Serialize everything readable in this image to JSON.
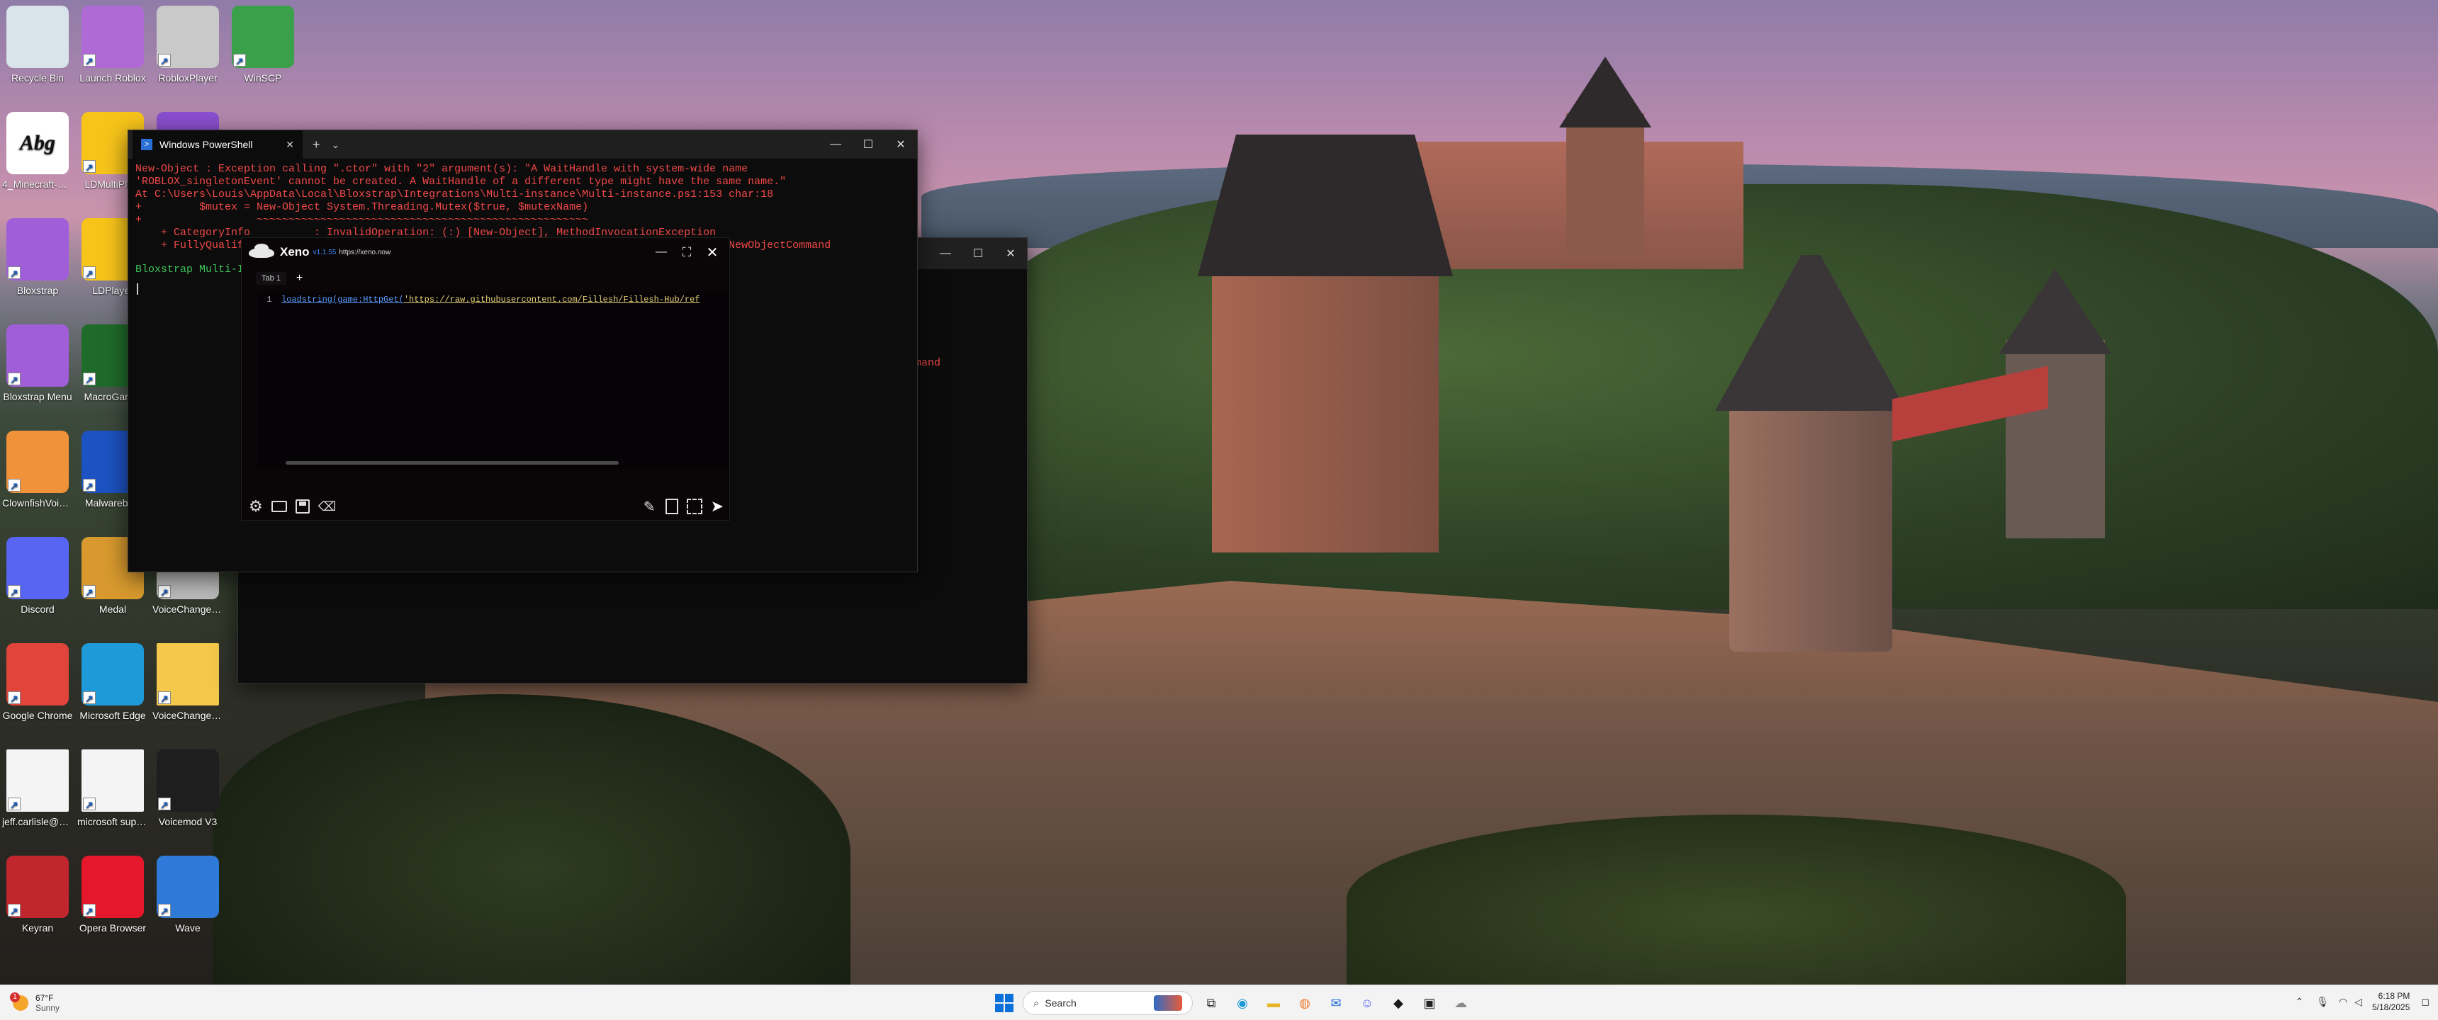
{
  "desktop": {
    "icons": [
      {
        "label": "Recycle Bin",
        "icon": "recycle-bin-icon",
        "color": "#d8e3ea"
      },
      {
        "label": "Launch Roblox",
        "icon": "roblox-launcher-icon",
        "color": "#b06ad6"
      },
      {
        "label": "RobloxPlayer",
        "icon": "roblox-player-icon",
        "color": "#c9c9c9"
      },
      {
        "label": "WinSCP",
        "icon": "winscp-icon",
        "color": "#3aa14a"
      },
      {
        "label": "4_Minecraft-Bol...",
        "icon": "document-abg-icon",
        "glyph": "Abg",
        "color": "#ffffff"
      },
      {
        "label": "LDMultiPla...",
        "icon": "ldplayer-multi-icon",
        "color": "#f7c41a"
      },
      {
        "label": "",
        "icon": "app-purple-icon",
        "color": "#8a4fd0"
      },
      {
        "label": "Bloxstrap",
        "icon": "bloxstrap-icon",
        "color": "#a05fd8"
      },
      {
        "label": "LDPlayer",
        "icon": "ldplayer-icon",
        "color": "#f7c41a"
      },
      {
        "label": "Bloxstrap Menu",
        "icon": "bloxstrap-menu-icon",
        "color": "#a05fd8"
      },
      {
        "label": "MacroGam...",
        "icon": "macro-game-icon",
        "color": "#1f6b2a"
      },
      {
        "label": "ClownfishVoiceC...",
        "icon": "clownfish-icon",
        "color": "#f0923a"
      },
      {
        "label": "Malwareby...",
        "icon": "malwarebytes-icon",
        "color": "#1c52c2"
      },
      {
        "label": "Discord",
        "icon": "discord-icon",
        "color": "#5865f2"
      },
      {
        "label": "Medal",
        "icon": "medal-icon",
        "color": "#d89a2e"
      },
      {
        "label": "VoiceChanger64(...",
        "icon": "voicechanger-icon",
        "color": "#bbbbbb"
      },
      {
        "label": "Google Chrome",
        "icon": "chrome-icon",
        "color": "#e0443a"
      },
      {
        "label": "Microsoft Edge",
        "icon": "edge-icon",
        "color": "#1f9ad8"
      },
      {
        "label": "VoiceChanger64(...",
        "icon": "folder-icon",
        "color": "#f3c84b"
      },
      {
        "label": "jeff.carlisle@secu...",
        "icon": "file-icon",
        "color": "#f4f4f4"
      },
      {
        "label": "microsoft support",
        "icon": "file-icon",
        "color": "#f4f4f4"
      },
      {
        "label": "Voicemod V3",
        "icon": "voicemod-icon",
        "color": "#1e1e1e"
      },
      {
        "label": "Keyran",
        "icon": "keyran-mouse-icon",
        "color": "#c0262d"
      },
      {
        "label": "Opera Browser",
        "icon": "opera-icon",
        "color": "#e5172a"
      },
      {
        "label": "Wave",
        "icon": "wave-icon",
        "color": "#2f7ad8"
      }
    ]
  },
  "powershell": {
    "tab_title": "Windows PowerShell",
    "lines": [
      {
        "text": "New-Object : Exception calling \".ctor\" with \"2\" argument(s): \"A WaitHandle with system-wide name",
        "color": "#f04848"
      },
      {
        "text": "'ROBLOX_singletonEvent' cannot be created. A WaitHandle of a different type might have the same name.\"",
        "color": "#f04848"
      },
      {
        "text": "At C:\\Users\\Louis\\AppData\\Local\\Bloxstrap\\Integrations\\Multi-instance\\Multi-instance.ps1:153 char:18",
        "color": "#f04848"
      },
      {
        "text": "+         $mutex = New-Object System.Threading.Mutex($true, $mutexName)",
        "color": "#f04848"
      },
      {
        "text": "+                  ~~~~~~~~~~~~~~~~~~~~~~~~~~~~~~~~~~~~~~~~~~~~~~~~~~~~",
        "color": "#f04848"
      },
      {
        "text": "    + CategoryInfo          : InvalidOperation: (:) [New-Object], MethodInvocationException",
        "color": "#f04848"
      },
      {
        "text": "    + FullyQualifiedErrorId : ConstructorInvokedThrowException,Microsoft.PowerShell.Commands.NewObjectCommand",
        "color": "#f04848"
      },
      {
        "text": "",
        "color": "#f04848"
      },
      {
        "text": "Bloxstrap Multi-Instance",
        "color": "#3ec25a"
      }
    ],
    "back_fragment_1": "ewObjectCommand",
    "back_fragment_2": "mand"
  },
  "xeno": {
    "title": "Xeno",
    "version": "v1.1.55",
    "url": "https://xeno.now",
    "tab_label": "Tab 1",
    "add_tab": "+",
    "line_number": "1",
    "code_fn": "loadstring(game:HttpGet(",
    "code_str": "'https://raw.githubusercontent.com/Fillesh/Fillesh-Hub/ref"
  },
  "taskbar": {
    "weather_temp": "67°F",
    "weather_desc": "Sunny",
    "weather_badge": "1",
    "search_placeholder": "Search",
    "time": "6:18 PM",
    "date": "5/18/2025"
  }
}
